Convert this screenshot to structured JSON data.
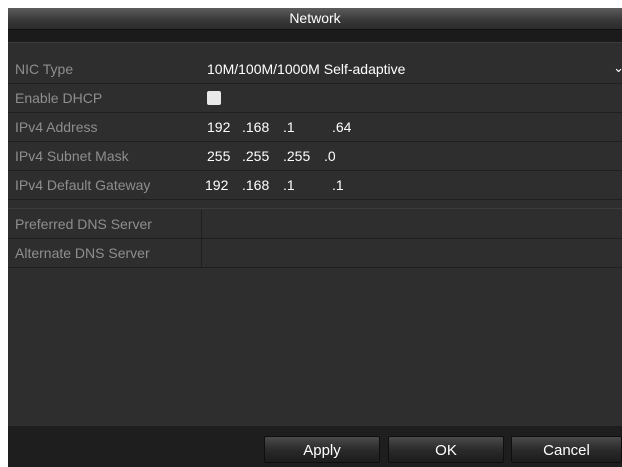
{
  "window": {
    "title": "Network"
  },
  "form": {
    "nic_type": {
      "label": "NIC Type",
      "value": "10M/100M/1000M Self-adaptive"
    },
    "enable_dhcp": {
      "label": "Enable DHCP",
      "checked": false
    },
    "ipv4_address": {
      "label": "IPv4 Address",
      "octets": [
        "192",
        ".168",
        ".1",
        ".64"
      ]
    },
    "ipv4_subnet_mask": {
      "label": "IPv4 Subnet Mask",
      "octets": [
        "255",
        ".255",
        ".255",
        ".0"
      ]
    },
    "ipv4_default_gateway": {
      "label": "IPv4 Default Gateway",
      "octets": [
        "192",
        ".168",
        ".1",
        ".1"
      ]
    }
  },
  "dns": {
    "preferred": {
      "label": "Preferred DNS Server",
      "value": ""
    },
    "alternate": {
      "label": "Alternate DNS Server",
      "value": ""
    }
  },
  "buttons": {
    "apply": "Apply",
    "ok": "OK",
    "cancel": "Cancel"
  },
  "icons": {
    "dropdown": "chevron-down-icon",
    "checkbox": "checkbox-unchecked"
  }
}
